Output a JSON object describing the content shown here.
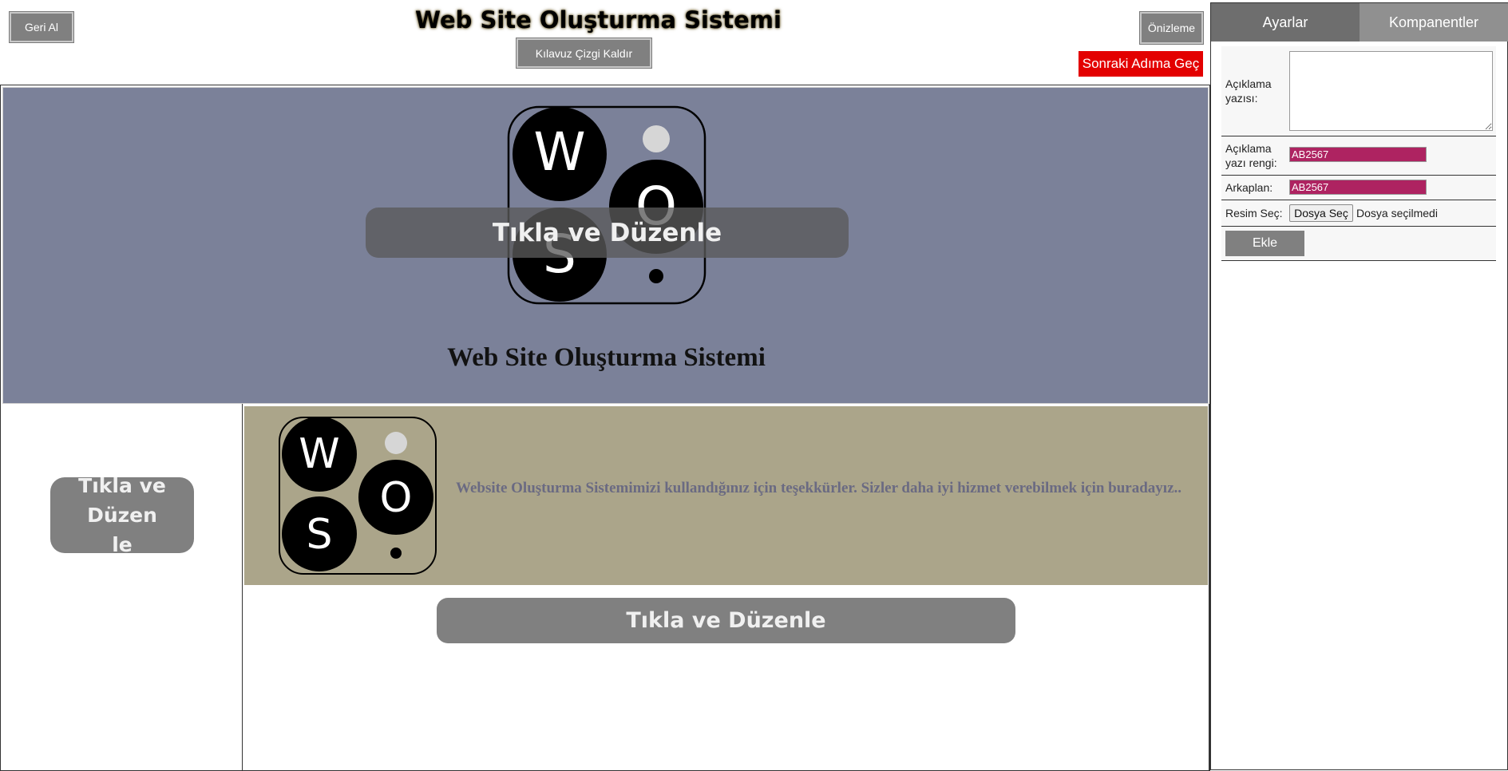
{
  "toolbar": {
    "undo_label": "Geri Al",
    "title": "Web Site Oluşturma Sistemi",
    "guide_label": "Kılavuz Çizgi Kaldır",
    "preview_label": "Önizleme",
    "next_label": "Sonraki Adıma Geç"
  },
  "canvas": {
    "header": {
      "edit_label": "Tıkla ve Düzenle",
      "site_title": "Web Site Oluşturma Sistemi",
      "logo_letters": [
        "W",
        "O",
        "S"
      ]
    },
    "sidebar": {
      "edit_label_line1": "Tıkla ve Düzen",
      "edit_label_line2": "le"
    },
    "content": {
      "logo_letters": [
        "W",
        "O",
        "S"
      ],
      "text": "Website Oluşturma Sistemimizi kullandığınız için teşekkürler. Sizler daha iyi hizmet verebilmek için buradayız..",
      "edit_label": "Tıkla ve Düzenle"
    }
  },
  "panel": {
    "tabs": [
      "Ayarlar",
      "Kompanentler"
    ],
    "active_tab": "Ayarlar",
    "form": {
      "desc_label_line1": "Açıklama",
      "desc_label_line2": "yazısı:",
      "desc_value": "",
      "desc_color_label_line1": "Açıklama",
      "desc_color_label_line2": "yazı rengi:",
      "desc_color_value": "AB2567",
      "bg_label": "Arkaplan:",
      "bg_value": "AB2567",
      "image_label": "Resim Seç:",
      "file_button": "Dosya Seç",
      "file_status": "Dosya seçilmedi",
      "add_button": "Ekle"
    }
  },
  "colors": {
    "header_bg": "#7b8199",
    "content_bg": "#aba58a",
    "accent_red": "#e30000",
    "color_swatch": "#ae2361",
    "tab_active": "#6e6e6e",
    "tab_inactive": "#909090"
  }
}
